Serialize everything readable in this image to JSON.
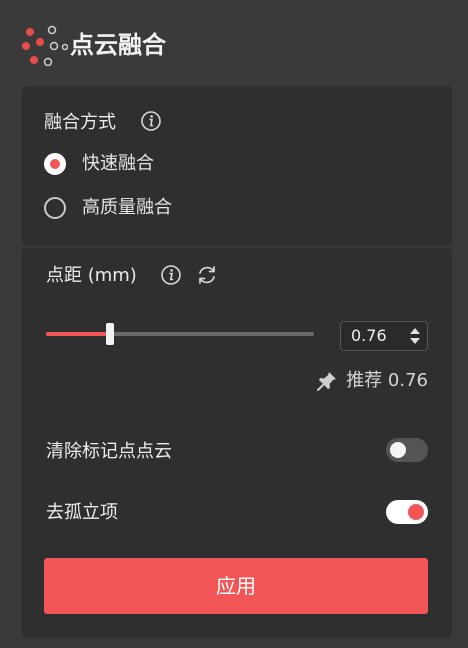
{
  "header": {
    "title": "点云融合",
    "icon": "point-cloud-logo-icon"
  },
  "fusion": {
    "label": "融合方式",
    "options": [
      {
        "label": "快速融合",
        "checked": true
      },
      {
        "label": "高质量融合",
        "checked": false
      }
    ]
  },
  "distance": {
    "label": "点距 (mm)",
    "value": "0.76",
    "slider_fraction": 0.24,
    "recommend_text": "推荐 0.76"
  },
  "toggles": [
    {
      "label": "清除标记点点云",
      "on": false
    },
    {
      "label": "去孤立项",
      "on": true
    }
  ],
  "apply": {
    "label": "应用"
  },
  "colors": {
    "accent": "#f25555",
    "background": "#3a3a3a",
    "panel": "#2f2f2f"
  }
}
